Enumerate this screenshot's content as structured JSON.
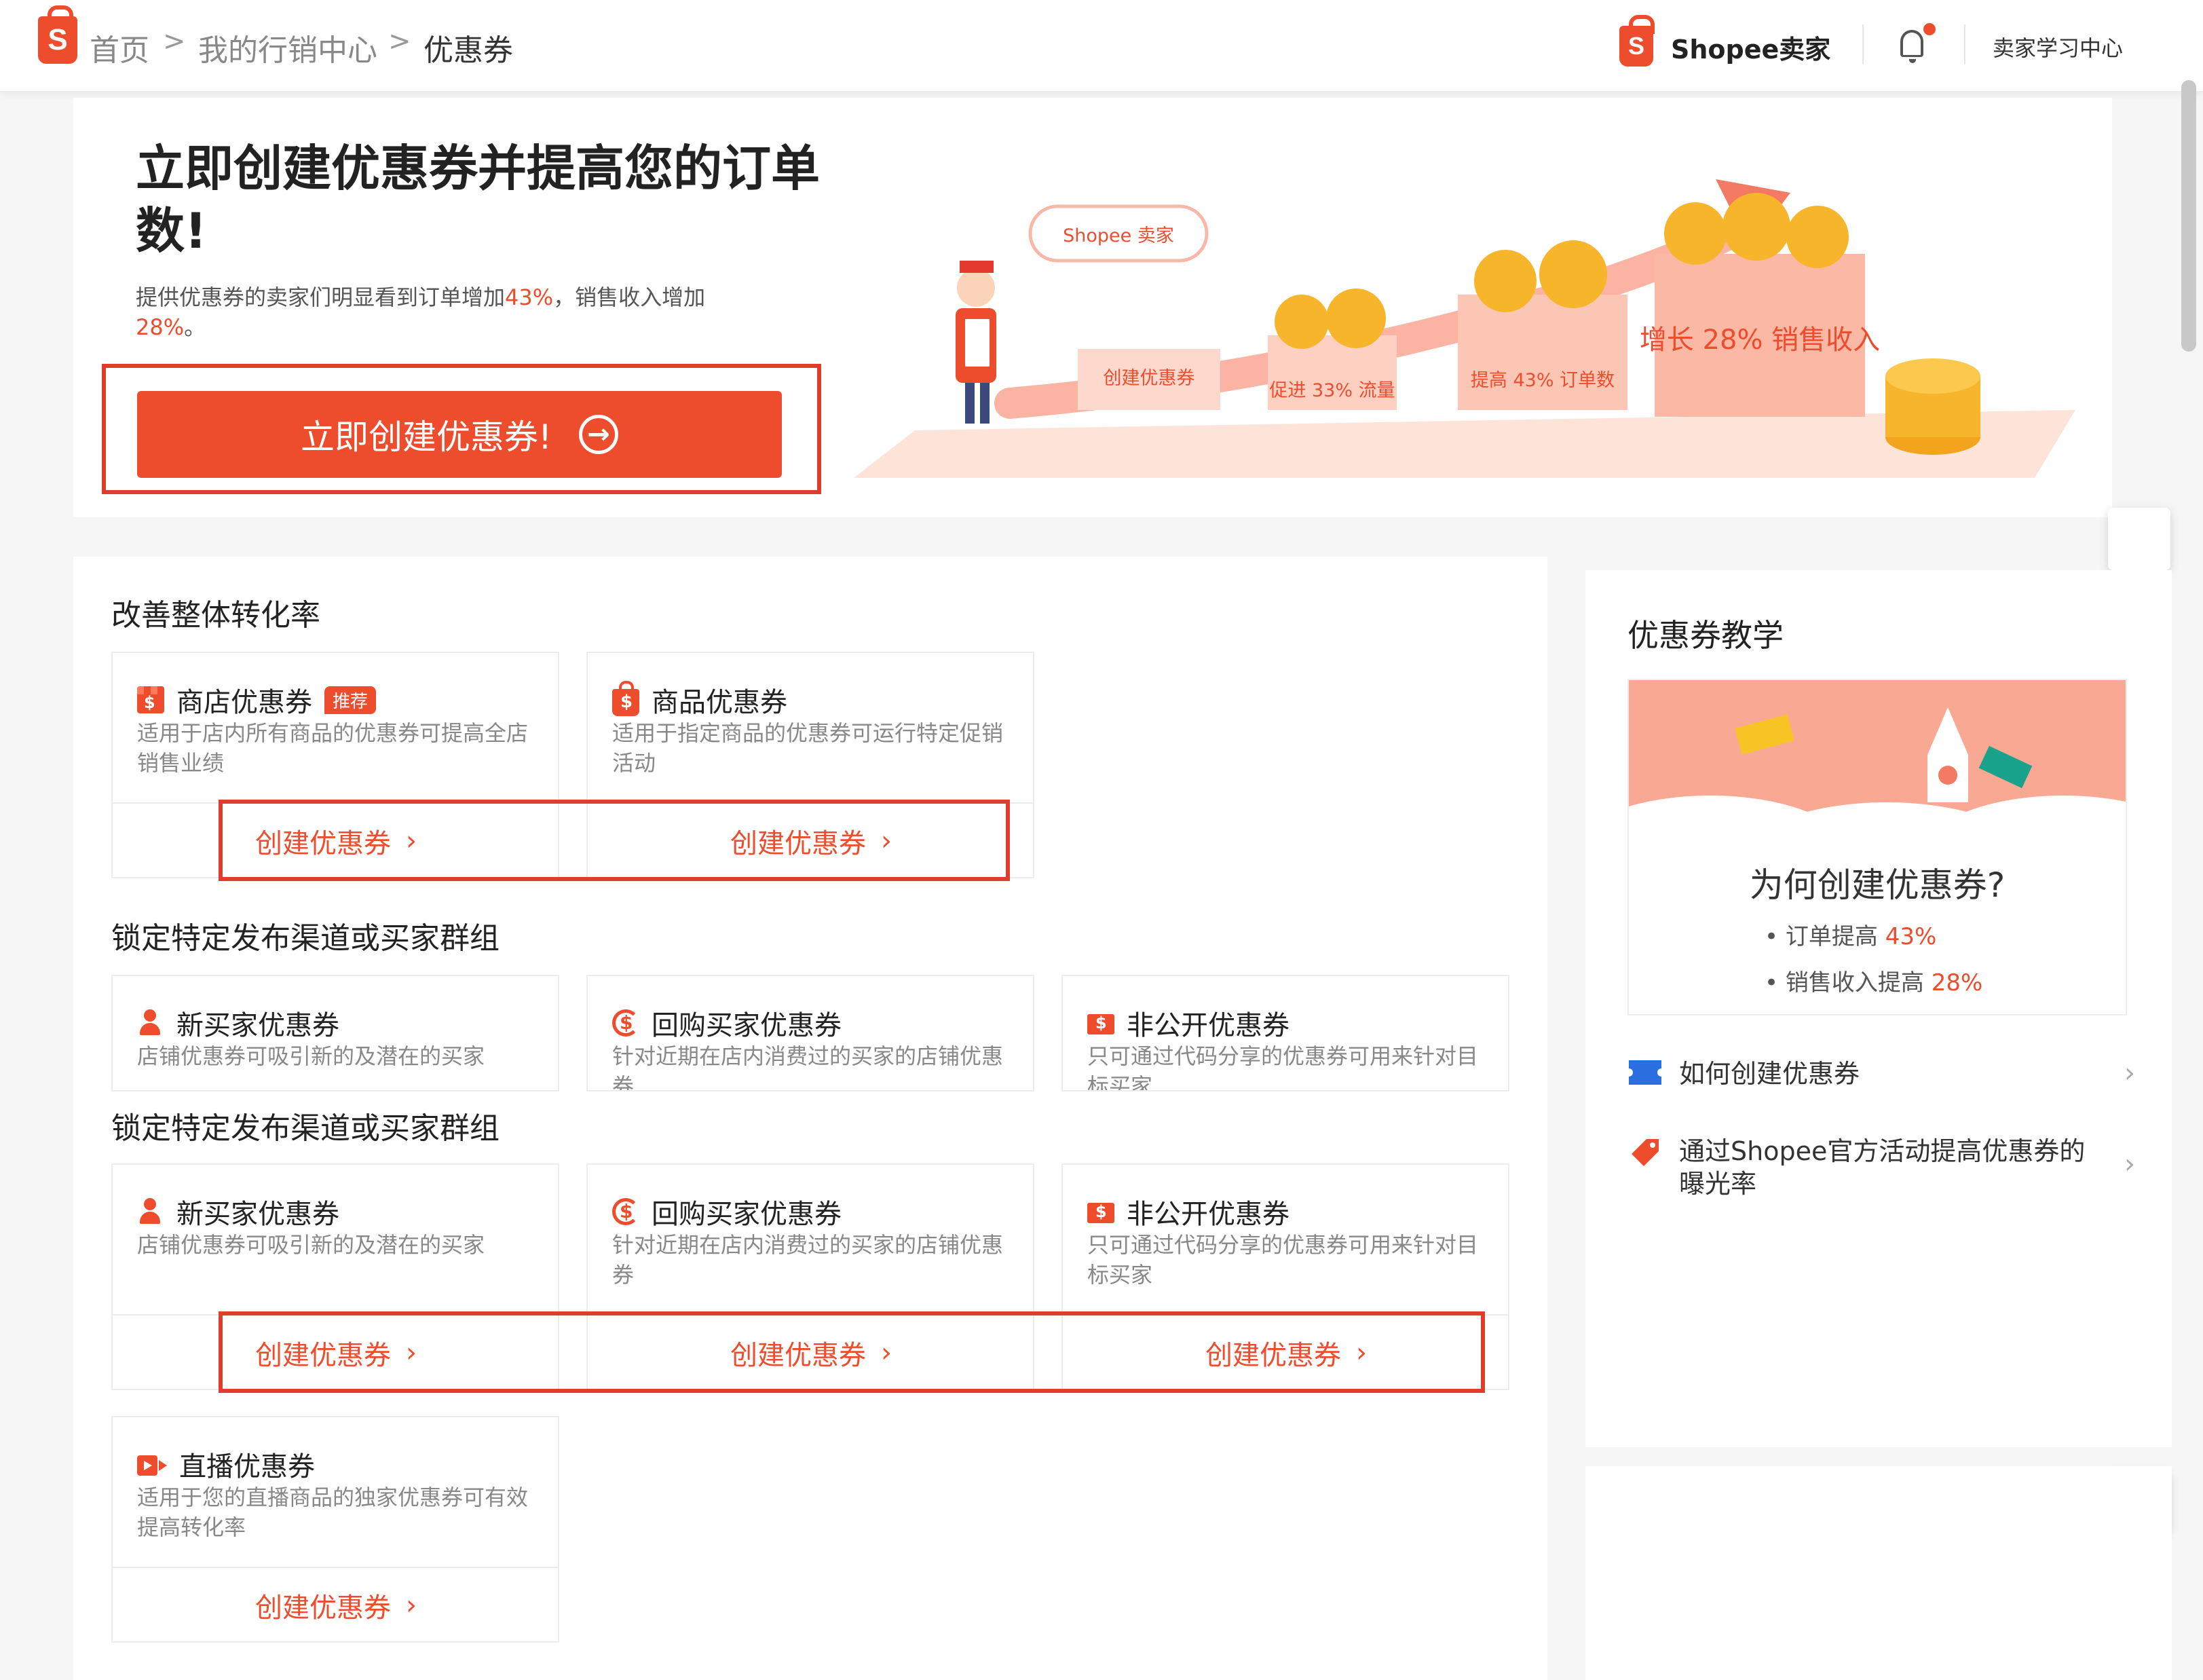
{
  "breadcrumb": {
    "home": "首页",
    "marketing": "我的行销中心",
    "current": "优惠券",
    "separator": ">"
  },
  "header": {
    "brand_letter": "S",
    "seller_label": "Shopee卖家",
    "learn_center": "卖家学习中心"
  },
  "hero": {
    "title": "立即创建优惠券并提高您的订单数!",
    "subtitle_prefix": "提供优惠券的卖家们明显看到订单增加",
    "order_pct": "43%",
    "subtitle_mid": "，销售收入增加",
    "revenue_pct": "28%",
    "subtitle_end": "。",
    "button_label": "立即创建优惠券!",
    "illustration": {
      "bubble": "Shopee 卖家",
      "steps": [
        "创建优惠券",
        "促进 33% 流量",
        "提高 43% 订单数",
        "增长 28% 销售收入"
      ]
    }
  },
  "sections": [
    {
      "title": "改善整体转化率",
      "cards": [
        {
          "icon": "shop-voucher-icon",
          "name": "商店优惠券",
          "badge": "推荐",
          "desc": "适用于店内所有商品的优惠券可提高全店销售业绩",
          "action": "创建优惠券"
        },
        {
          "icon": "product-voucher-icon",
          "name": "商品优惠券",
          "desc": "适用于指定商品的优惠券可运行特定促销活动",
          "action": "创建优惠券"
        }
      ]
    },
    {
      "title": "锁定特定发布渠道或买家群组",
      "cards": [
        {
          "icon": "new-buyer-icon",
          "name": "新买家优惠券",
          "desc": "店铺优惠券可吸引新的及潜在的买家"
        },
        {
          "icon": "repeat-buyer-icon",
          "name": "回购买家优惠券",
          "desc": "针对近期在店内消费过的买家的店铺优惠券"
        },
        {
          "icon": "private-voucher-icon",
          "name": "非公开优惠券",
          "desc": "只可通过代码分享的优惠券可用来针对目标买家"
        }
      ]
    },
    {
      "title": "锁定特定发布渠道或买家群组",
      "cards": [
        {
          "icon": "new-buyer-icon",
          "name": "新买家优惠券",
          "desc": "店铺优惠券可吸引新的及潜在的买家",
          "action": "创建优惠券"
        },
        {
          "icon": "repeat-buyer-icon",
          "name": "回购买家优惠券",
          "desc": "针对近期在店内消费过的买家的店铺优惠券",
          "action": "创建优惠券"
        },
        {
          "icon": "private-voucher-icon",
          "name": "非公开优惠券",
          "desc": "只可通过代码分享的优惠券可用来针对目标买家",
          "action": "创建优惠券"
        },
        {
          "icon": "live-voucher-icon",
          "name": "直播优惠券",
          "desc": "适用于您的直播商品的独家优惠券可有效提高转化率",
          "action": "创建优惠券"
        }
      ]
    }
  ],
  "sidebar": {
    "title": "优惠券教学",
    "question": "为何创建优惠券?",
    "points": [
      {
        "label": "订单提高",
        "value": "43%"
      },
      {
        "label": "销售收入提高",
        "value": "28%"
      }
    ],
    "links": [
      {
        "icon": "ticket-icon",
        "label": "如何创建优惠券"
      },
      {
        "icon": "tag-icon",
        "label": "通过Shopee官方活动提高优惠券的曝光率"
      }
    ]
  },
  "colors": {
    "brand": "#ee4d2d",
    "highlight_box": "#e03e2d"
  },
  "chevron": "›",
  "bullet": "•"
}
